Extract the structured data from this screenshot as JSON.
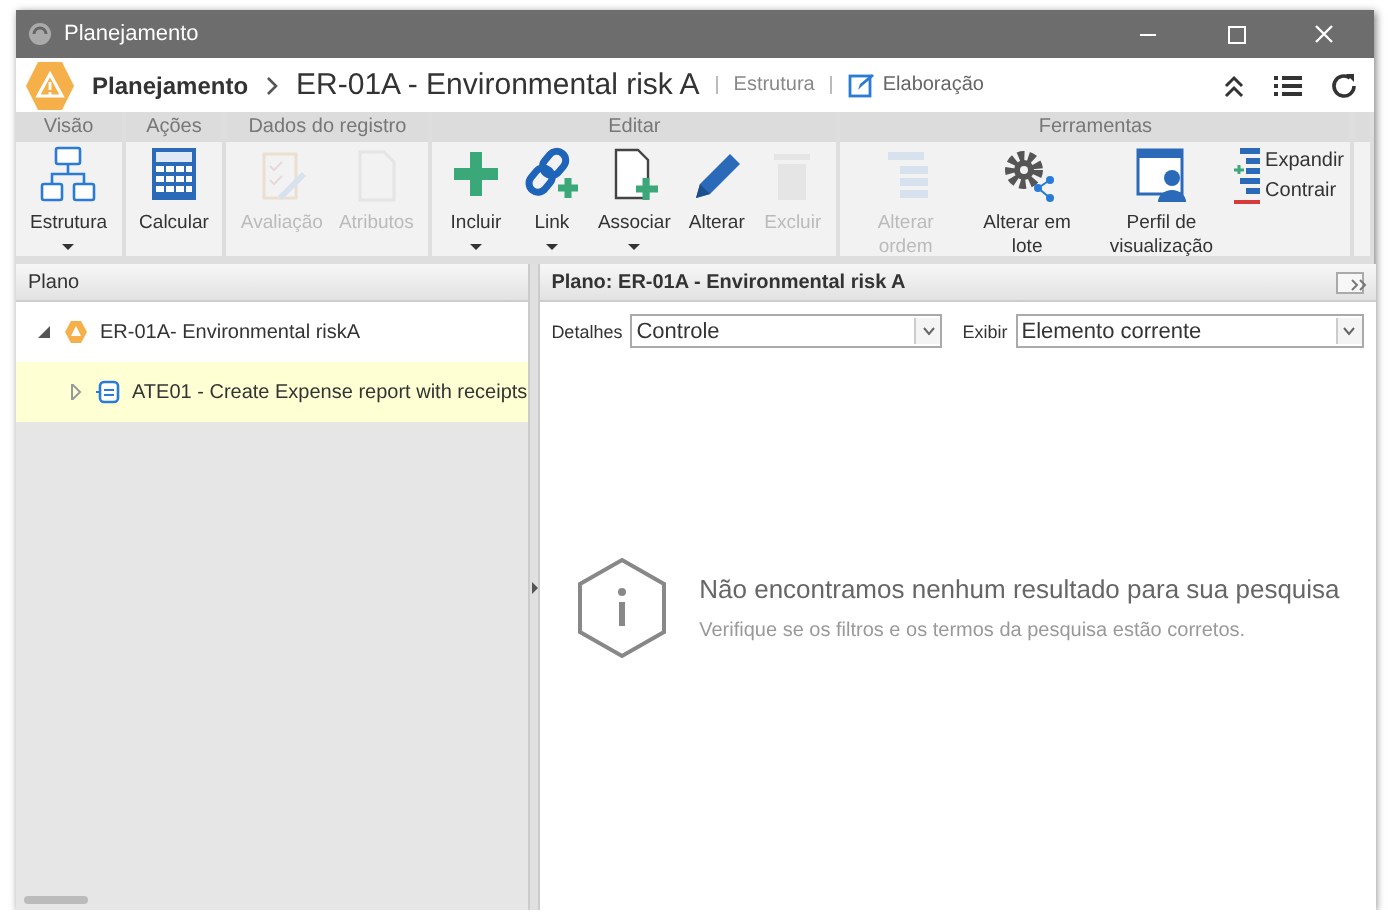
{
  "window": {
    "title": "Planejamento"
  },
  "header": {
    "module": "Planejamento",
    "record": "ER-01A - Environmental risk A",
    "links": [
      {
        "label": "Estrutura",
        "selected": false
      },
      {
        "label": "Elaboração",
        "selected": true
      }
    ]
  },
  "ribbon": [
    {
      "label": "Visão",
      "buttons": [
        {
          "label": "Estrutura",
          "disabled": false,
          "menu": true,
          "kind": "large"
        }
      ]
    },
    {
      "label": "Ações",
      "buttons": [
        {
          "label": "Calcular",
          "disabled": false,
          "menu": false,
          "kind": "large"
        }
      ]
    },
    {
      "label": "Dados do registro",
      "buttons": [
        {
          "label": "Avaliação",
          "disabled": true,
          "menu": false,
          "kind": "large"
        },
        {
          "label": "Atributos",
          "disabled": true,
          "menu": false,
          "kind": "large"
        }
      ]
    },
    {
      "label": "Editar",
      "buttons": [
        {
          "label": "Incluir",
          "disabled": false,
          "menu": true,
          "kind": "large"
        },
        {
          "label": "Link",
          "disabled": false,
          "menu": true,
          "kind": "large"
        },
        {
          "label": "Associar",
          "disabled": false,
          "menu": true,
          "kind": "large"
        },
        {
          "label": "Alterar",
          "disabled": false,
          "menu": false,
          "kind": "large"
        },
        {
          "label": "Excluir",
          "disabled": true,
          "menu": false,
          "kind": "large"
        }
      ]
    },
    {
      "label": "Ferramentas",
      "buttons": [
        {
          "label": "Alterar ordem",
          "disabled": true,
          "menu": false,
          "kind": "large"
        },
        {
          "label": "Alterar em lote",
          "disabled": false,
          "menu": false,
          "kind": "large"
        },
        {
          "label": "Perfil de visualização",
          "disabled": false,
          "menu": false,
          "kind": "large"
        },
        {
          "label": "Expandir",
          "disabled": false,
          "kind": "small"
        },
        {
          "label": "Contrair",
          "disabled": false,
          "kind": "small"
        }
      ]
    }
  ],
  "left_panel": {
    "title": "Plano",
    "tree": [
      {
        "label": "ER-01A- Environmental riskA",
        "expanded": true,
        "selected": false,
        "children": [
          {
            "label": "ATE01 - Create Expense report with receipts",
            "expanded": false,
            "selected": true
          }
        ]
      }
    ]
  },
  "right_panel": {
    "title": "Plano: ER-01A - Environmental risk A",
    "filters": [
      {
        "label": "Detalhes",
        "value": "Controle"
      },
      {
        "label": "Exibir",
        "value": "Elemento corrente"
      }
    ],
    "empty_state": {
      "title": "Não encontramos nenhum resultado para sua pesquisa",
      "hint": "Verifique se os filtros e os termos da pesquisa estão corretos."
    }
  }
}
